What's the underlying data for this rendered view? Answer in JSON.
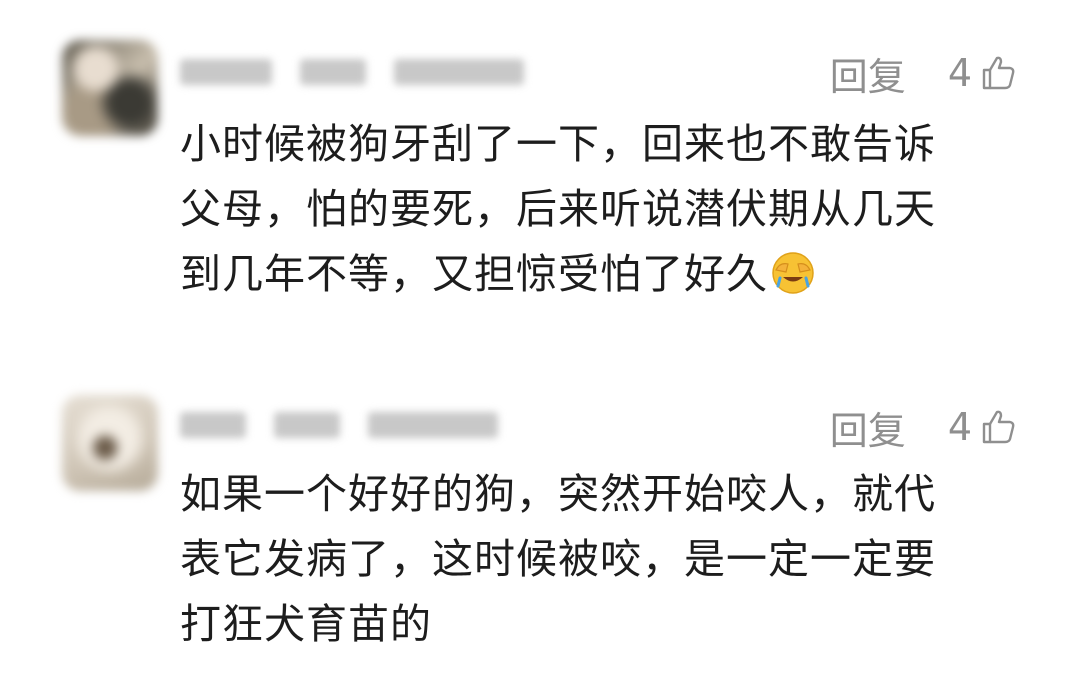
{
  "comments": [
    {
      "lines": [
        "小时候被狗牙刮了一下，回来也不敢告诉",
        "父母，怕的要死，后来听说潜伏期从几天",
        "到几年不等，又担惊受怕了好久"
      ],
      "reply_label": "回复",
      "likes": "4",
      "emoji": "facepalm-laugh-emoji"
    },
    {
      "lines": [
        "如果一个好好的狗，突然开始咬人，就代",
        "表它发病了，这时候被咬，是一定一定要",
        "打狂犬育苗的"
      ],
      "reply_label": "回复",
      "likes": "4"
    }
  ],
  "icons": {
    "like": "thumbs-up-icon"
  },
  "colors": {
    "action_gray": "#8f8f8f",
    "text": "#1d1d1d",
    "background": "#ffffff"
  }
}
